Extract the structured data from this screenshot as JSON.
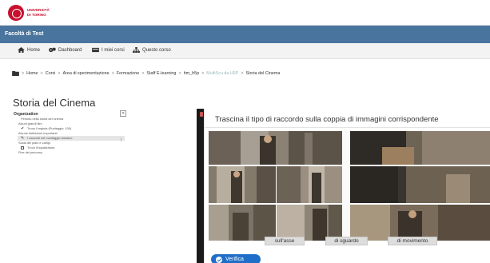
{
  "logo": {
    "line1": "UNIVERSITÀ",
    "line2": "DI TORINO"
  },
  "site": {
    "name": "Facoltà di Test"
  },
  "nav": {
    "items": [
      {
        "label": "Home",
        "icon": "home-icon"
      },
      {
        "label": "Dashboard",
        "icon": "dashboard-icon"
      },
      {
        "label": "I miei corsi",
        "icon": "courses-icon"
      },
      {
        "label": "Questo corso",
        "icon": "sitemap-icon"
      }
    ]
  },
  "breadcrumb": {
    "items": [
      "Home",
      "Corsi",
      "Area di sperimentazione",
      "Formazione",
      "Staff E-learning",
      "hm_h5p",
      "MultiScu da H5P",
      "Storia del Cinema"
    ],
    "separator": ">"
  },
  "page": {
    "title": "Storia del Cinema"
  },
  "organization": {
    "heading": "Organization",
    "toggle": "«",
    "rows": [
      {
        "label": "Periodo nella storia del cinema",
        "kind": "item",
        "mark": ""
      },
      {
        "label": "Alcuni grandi film",
        "kind": "section",
        "mark": ""
      },
      {
        "label": "Trova il regista (Punteggio: 100)",
        "kind": "item",
        "mark": "✔"
      },
      {
        "label": "Alcune definizioni importanti",
        "kind": "section",
        "mark": ""
      },
      {
        "label": "I raccordi nel montaggio classico",
        "kind": "item",
        "mark": "✎",
        "active": true
      },
      {
        "label": "Scala dei piani e campi",
        "kind": "section",
        "mark": ""
      },
      {
        "label": "Trova l'inquadratura",
        "kind": "item",
        "mark": "box"
      },
      {
        "label": "Fine del percorso",
        "kind": "section",
        "mark": ""
      }
    ]
  },
  "activity": {
    "instruction": "Trascina il tipo di raccordo sulla coppia di immagini corrispondente",
    "labels": [
      "sull'asse",
      "di sguardo",
      "di movimento"
    ],
    "check_button": "Verifica"
  },
  "colors": {
    "brand_red": "#c8102e",
    "site_bar": "#48749e",
    "button_blue": "#1f6fc8"
  }
}
